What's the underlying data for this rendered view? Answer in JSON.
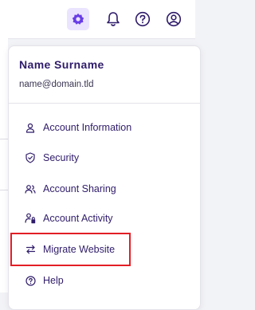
{
  "header": {
    "icons": [
      "settings-icon",
      "bell-icon",
      "help-icon",
      "user-icon"
    ],
    "accent_color": "#673de6"
  },
  "profile": {
    "name": "Name Surname",
    "email": "name@domain.tld"
  },
  "menu": {
    "items": [
      {
        "label": "Account Information",
        "icon": "user-icon"
      },
      {
        "label": "Security",
        "icon": "shield-icon"
      },
      {
        "label": "Account Sharing",
        "icon": "users-icon"
      },
      {
        "label": "Account Activity",
        "icon": "user-activity-icon"
      },
      {
        "label": "Migrate Website",
        "icon": "transfer-icon",
        "highlighted": true
      },
      {
        "label": "Help",
        "icon": "help-circle-icon"
      }
    ],
    "highlight_color": "#e31e25"
  }
}
